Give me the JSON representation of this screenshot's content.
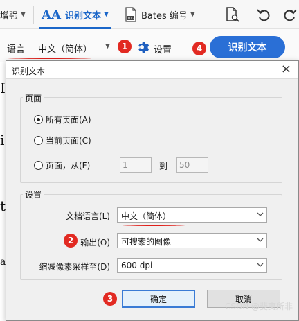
{
  "toolbar": {
    "enhance_label": "增强",
    "ocr_tab_label": "识别文本",
    "bates_label": "Bates 编号",
    "ocr_active_color": "#1a66c9"
  },
  "ocr_bar": {
    "language_label": "语言",
    "language_value": "中文（简体）",
    "settings_label": "设置",
    "recognize_button": "识别文本",
    "button_color": "#2a6fd6"
  },
  "background_page": {
    "frag1": "I",
    "frag2": "i",
    "frag3": "t",
    "frag4": "a"
  },
  "annotations": {
    "badge1": "1",
    "badge2": "2",
    "badge3": "3",
    "badge4": "4",
    "badge_color": "#e22a22"
  },
  "dialog": {
    "title": "识别文本",
    "close": "×",
    "pages_group": {
      "title": "页面",
      "all_pages": "所有页面(A)",
      "current_page": "当前页面(C)",
      "range": "页面，从(F)",
      "from_value": "1",
      "to_label": "到",
      "to_value": "50",
      "selected": "all_pages"
    },
    "settings_group": {
      "title": "设置",
      "doc_language_label": "文档语言(L)",
      "doc_language_value": "中文（简体）",
      "output_label": "输出(O)",
      "output_value": "可搜索的图像",
      "downsample_label": "缩减像素采样至(D)",
      "downsample_value": "600 dpi"
    },
    "ok_button": "确定",
    "cancel_button": "取消"
  },
  "watermark": "CSDN @斐夷所非"
}
